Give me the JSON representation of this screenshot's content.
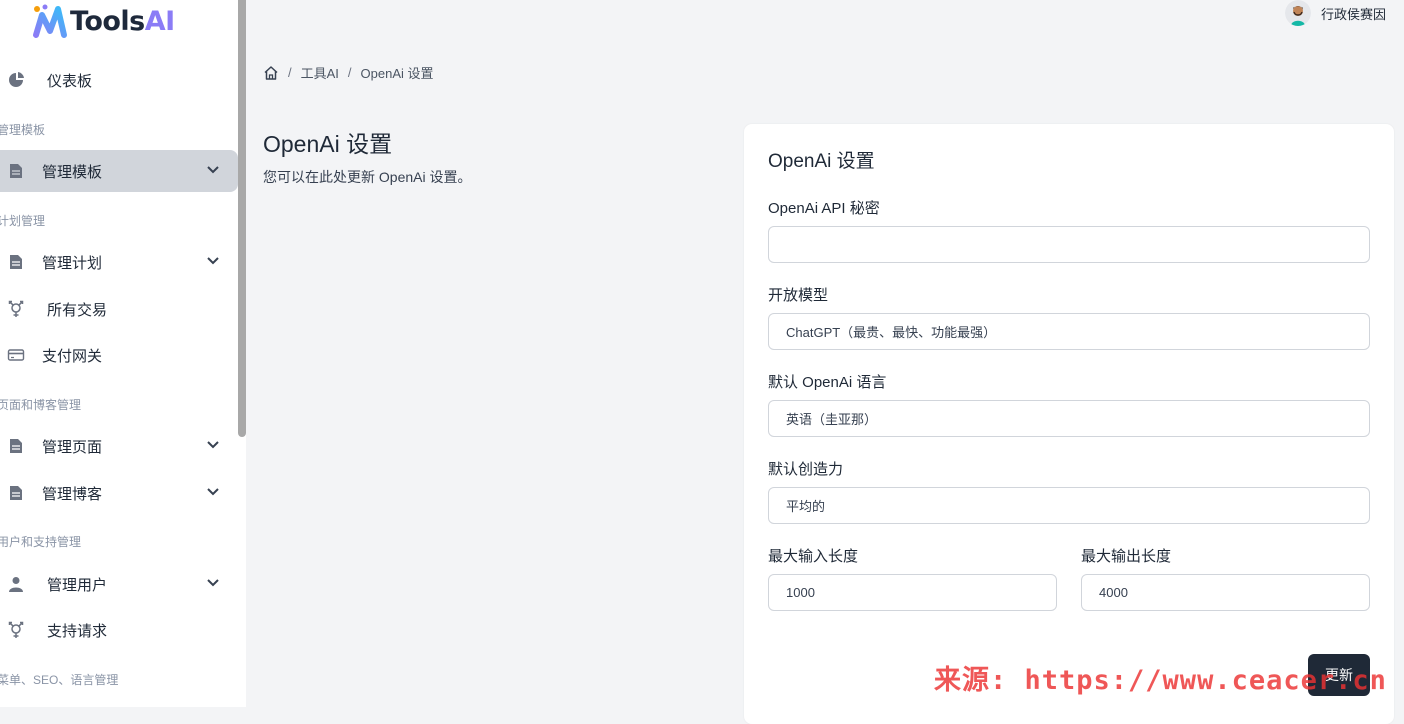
{
  "app": {
    "logo_text_main": "Tools",
    "logo_text_accent": "AI"
  },
  "header": {
    "user_name": "行政侯赛因"
  },
  "sidebar": {
    "items": [
      {
        "label": "仪表板",
        "icon": "pie-chart-icon"
      },
      {
        "section": "管理模板"
      },
      {
        "label": "管理模板",
        "icon": "document-icon",
        "active": true,
        "has_chevron": true
      },
      {
        "section": "计划管理"
      },
      {
        "label": "管理计划",
        "icon": "document-icon",
        "has_chevron": true
      },
      {
        "label": "所有交易",
        "icon": "transgender-icon"
      },
      {
        "label": "支付网关",
        "icon": "credit-card-icon"
      },
      {
        "section": "页面和博客管理"
      },
      {
        "label": "管理页面",
        "icon": "document-icon",
        "has_chevron": true
      },
      {
        "label": "管理博客",
        "icon": "document-icon",
        "has_chevron": true
      },
      {
        "section": "用户和支持管理"
      },
      {
        "label": "管理用户",
        "icon": "user-icon",
        "has_chevron": true
      },
      {
        "label": "支持请求",
        "icon": "transgender-icon"
      },
      {
        "section": "菜单、SEO、语言管理"
      }
    ]
  },
  "breadcrumb": {
    "home_icon": "home-icon",
    "items": [
      "工具AI",
      "OpenAi 设置"
    ]
  },
  "page": {
    "title": "OpenAi 设置",
    "description": "您可以在此处更新 OpenAi 设置。"
  },
  "form": {
    "title": "OpenAi 设置",
    "api_key_label": "OpenAi API 秘密",
    "api_key_value": "",
    "model_label": "开放模型",
    "model_value": "ChatGPT（最贵、最快、功能最强）",
    "language_label": "默认 OpenAi 语言",
    "language_value": "英语（圭亚那）",
    "creativity_label": "默认创造力",
    "creativity_value": "平均的",
    "max_input_label": "最大输入长度",
    "max_input_value": "1000",
    "max_output_label": "最大输出长度",
    "max_output_value": "4000",
    "submit_label": "更新"
  },
  "watermark": "来源: https://www.ceacer.cn",
  "colors": {
    "sidebar_active": "#d1d5db",
    "button_bg": "#1f2937",
    "accent": "#8b7cf6"
  }
}
